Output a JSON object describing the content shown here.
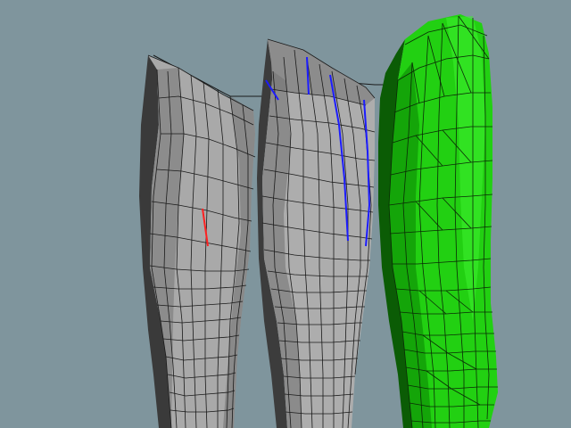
{
  "viewport": {
    "background_color": "#7f959d",
    "wire_color": "#1a1a1a",
    "selected_edge_color": "#ff2020",
    "highlight_edge_color": "#1c1cff"
  },
  "objects": [
    {
      "name": "left-leg-mesh",
      "fill": "#a9a9a9",
      "shade": "#6f6f6f",
      "dark": "#3a3a3a"
    },
    {
      "name": "middle-leg-mesh",
      "fill": "#adadad",
      "shade": "#747474",
      "dark": "#3c3c3c"
    },
    {
      "name": "right-leg-mesh-selected",
      "fill": "#22d012",
      "shade": "#119a08",
      "dark": "#0b5c05"
    }
  ]
}
